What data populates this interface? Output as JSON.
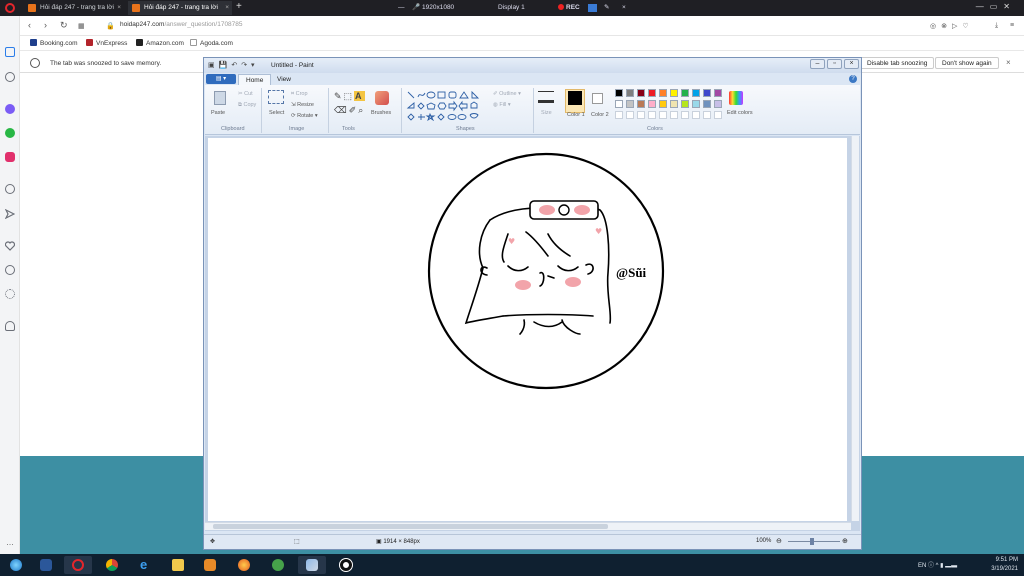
{
  "browser": {
    "tabs": [
      {
        "label": "Hỏi đáp 247 - trang tra lời",
        "active": false
      },
      {
        "label": "Hỏi đáp 247 - trang tra lời",
        "active": true
      }
    ],
    "new_tab_label": "+",
    "recording": {
      "resolution": "1920x1080",
      "display": "Display 1",
      "rec_label": "REC"
    },
    "url_host": "hoidap247.com",
    "url_path": "/answer_question/1708785",
    "bookmarks": [
      "Booking.com",
      "VnExpress",
      "Amazon.com",
      "Agoda.com"
    ],
    "snooze_message": "The tab was snoozed to save memory.",
    "disable_button": "Disable tab snoozing",
    "dont_show_button": "Don't show again"
  },
  "paint": {
    "title": "Untitled - Paint",
    "tabs": [
      "Home",
      "View"
    ],
    "ribbon": {
      "paste": "Paste",
      "cut": "Cut",
      "copy": "Copy",
      "select": "Select",
      "crop": "Crop",
      "resize": "Resize",
      "rotate": "Rotate",
      "brushes": "Brushes",
      "outline": "Outline",
      "fill": "Fill",
      "size": "Size",
      "color1": "Color 1",
      "color2": "Color 2",
      "edit_colors": "Edit colors",
      "groups": [
        "Clipboard",
        "Image",
        "Tools",
        "Shapes",
        "Colors"
      ]
    },
    "palette": [
      "#000000",
      "#7f7f7f",
      "#880015",
      "#ed1c24",
      "#ff7f27",
      "#fff200",
      "#22b14c",
      "#00a2e8",
      "#3f48cc",
      "#a349a4",
      "#ffffff",
      "#c3c3c3",
      "#b97a57",
      "#ffaec9",
      "#ffc90e",
      "#efe4b0",
      "#b5e61d",
      "#99d9ea",
      "#7092be",
      "#c8bfe7"
    ],
    "drawing": {
      "signature": "@Sũi"
    },
    "status": {
      "dimensions": "1914 × 848px",
      "zoom": "100%"
    }
  },
  "taskbar": {
    "time": "9:51 PM",
    "date": "3/19/2021"
  }
}
